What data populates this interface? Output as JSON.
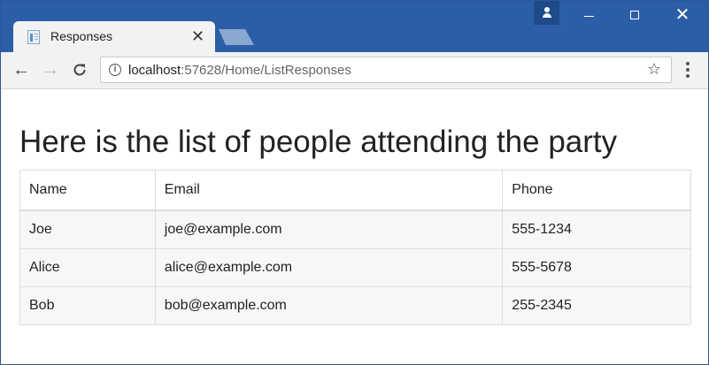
{
  "browser": {
    "tab": {
      "title": "Responses",
      "close_glyph": "✕"
    },
    "window_controls": {
      "close_glyph": "✕"
    },
    "toolbar": {
      "back_glyph": "←",
      "forward_glyph": "→",
      "reload_glyph": "C",
      "url_host": "localhost",
      "url_path": ":57628/Home/ListResponses",
      "star_glyph": "☆",
      "info_glyph": "i"
    },
    "colors": {
      "frame": "#2b5ea7",
      "profile": "#1f4a8a"
    }
  },
  "page": {
    "title": "Here is the list of people attending the party",
    "table": {
      "headers": [
        "Name",
        "Email",
        "Phone"
      ],
      "rows": [
        [
          "Joe",
          "joe@example.com",
          "555-1234"
        ],
        [
          "Alice",
          "alice@example.com",
          "555-5678"
        ],
        [
          "Bob",
          "bob@example.com",
          "255-2345"
        ]
      ]
    }
  }
}
